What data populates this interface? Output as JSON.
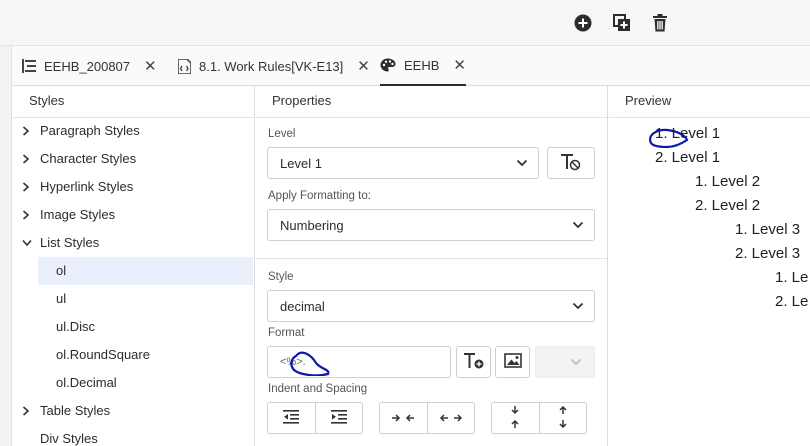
{
  "toolbar": {
    "icons": [
      "plus-circle-icon",
      "copy-add-icon",
      "trash-icon"
    ]
  },
  "tabs": [
    {
      "label": "EEHB_200807",
      "icon": "document-lines-icon",
      "active": false
    },
    {
      "label": "8.1. Work Rules[VK-E13]",
      "icon": "document-code-icon",
      "active": false
    },
    {
      "label": "EEHB",
      "icon": "palette-icon",
      "active": true
    }
  ],
  "styles_panel": {
    "title": "Styles",
    "groups": [
      {
        "label": "Paragraph Styles",
        "expanded": false
      },
      {
        "label": "Character Styles",
        "expanded": false
      },
      {
        "label": "Hyperlink Styles",
        "expanded": false
      },
      {
        "label": "Image Styles",
        "expanded": false
      },
      {
        "label": "List Styles",
        "expanded": true
      },
      {
        "label": "Table Styles",
        "expanded": false
      },
      {
        "label": "Div Styles",
        "expanded": false
      }
    ],
    "list_styles": [
      "ol",
      "ul",
      "ul.Disc",
      "ol.RoundSquare",
      "ol.Decimal"
    ],
    "selected": "ol"
  },
  "properties_panel": {
    "title": "Properties",
    "level_label": "Level",
    "level_value": "Level 1",
    "apply_label": "Apply Formatting to:",
    "apply_value": "Numbering",
    "style_label": "Style",
    "style_value": "decimal",
    "format_label": "Format",
    "format_value": "<%>.",
    "indent_label": "Indent and Spacing"
  },
  "preview_panel": {
    "title": "Preview",
    "lines": [
      "1. Level 1",
      "2. Level 1",
      "1. Level 2",
      "2. Level 2",
      "1. Level 3",
      "2. Level 3",
      "1. Le",
      "2. Le"
    ]
  },
  "colors": {
    "selection": "#e9f0fb",
    "annotation_ink": "#0a1aa8",
    "border": "#cfcfcf"
  }
}
